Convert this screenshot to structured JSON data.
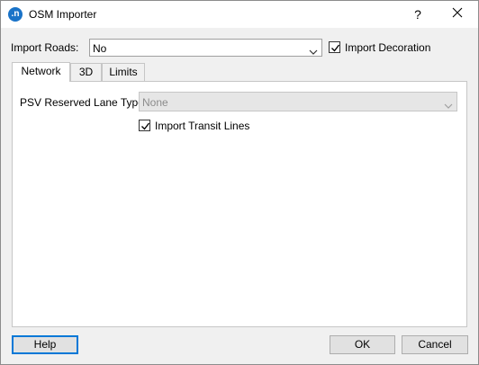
{
  "window": {
    "title": "OSM Importer",
    "app_icon_text": ".n",
    "help_glyph": "?",
    "close_glyph": "✕"
  },
  "import_roads": {
    "label": "Import Roads:",
    "value": "No"
  },
  "import_decoration": {
    "label": "Import Decoration",
    "checked": true
  },
  "tabs": [
    {
      "label": "Network",
      "active": true
    },
    {
      "label": "3D",
      "active": false
    },
    {
      "label": "Limits",
      "active": false
    }
  ],
  "network": {
    "psv_label": "PSV Reserved Lane Type:",
    "psv_value": "None",
    "psv_enabled": false,
    "transit_label": "Import Transit Lines",
    "transit_checked": true
  },
  "buttons": {
    "help": "Help",
    "ok": "OK",
    "cancel": "Cancel"
  },
  "colors": {
    "accent": "#0078d7",
    "app_icon": "#1a73c8",
    "dialog_bg": "#f0f0f0"
  }
}
